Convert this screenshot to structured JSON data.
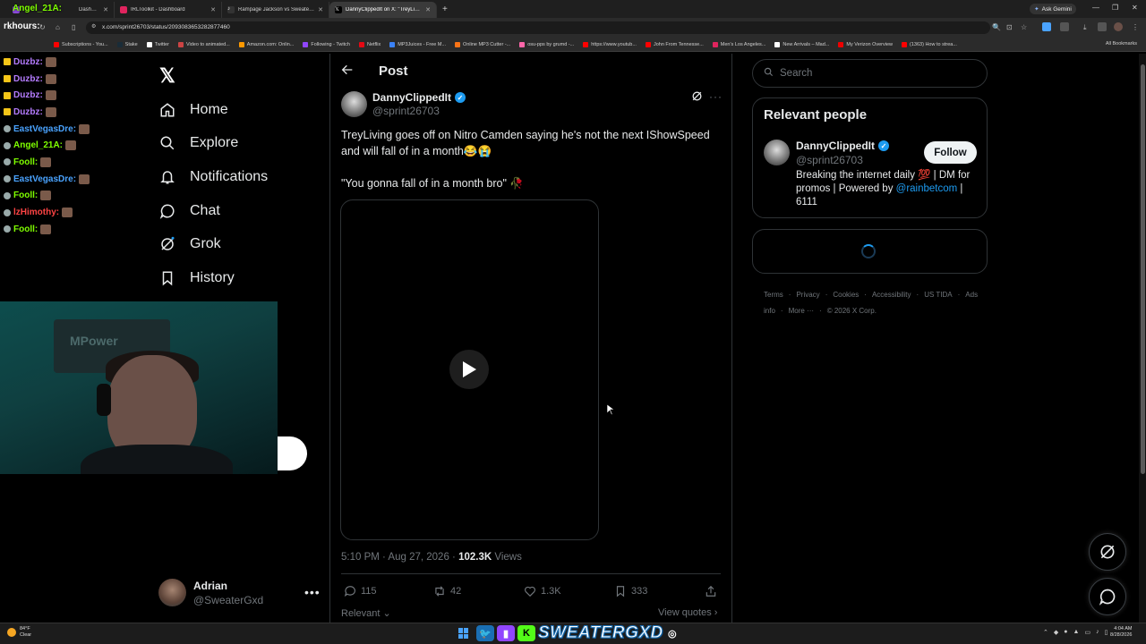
{
  "browser": {
    "tabs": [
      {
        "label": "Dashboard",
        "color": "#8a4bd8"
      },
      {
        "label": "IRLToolkit - Dashboard",
        "color": "#e0245e"
      },
      {
        "label": "Rampage Jackson vs Sweatergxd",
        "color": "#ffffff"
      },
      {
        "label": "DannyClippedIt on X: \"TreyLivi...",
        "color": "#ffffff"
      }
    ],
    "new_tab": "+",
    "ask_gemini": "Ask Gemini",
    "url": "x.com/sprint26703/status/2093083653282877460",
    "bookmarks": [
      {
        "label": "Subscriptions - You...",
        "color": "#ff0000"
      },
      {
        "label": "Stake",
        "color": "#1a2c38"
      },
      {
        "label": "Twitter",
        "color": "#ffffff"
      },
      {
        "label": "Video to animated...",
        "color": "#cc4444"
      },
      {
        "label": "Amazon.com: Onlin...",
        "color": "#ff9900"
      },
      {
        "label": "Following - Twitch",
        "color": "#9146ff"
      },
      {
        "label": "Netflix",
        "color": "#e50914"
      },
      {
        "label": "MP3Juices - Free M...",
        "color": "#3b82f6"
      },
      {
        "label": "Online MP3 Cutter -...",
        "color": "#f97316"
      },
      {
        "label": "osu-pps by grumd -...",
        "color": "#ff66aa"
      },
      {
        "label": "https://www.youtub...",
        "color": "#ff0000"
      },
      {
        "label": "John From Tennesse...",
        "color": "#ff0000"
      },
      {
        "label": "Men's Los Angeles...",
        "color": "#e0245e"
      },
      {
        "label": "New Arrivals – Mad...",
        "color": "#ffffff"
      },
      {
        "label": "My Verizon Overview",
        "color": "#ee0000"
      },
      {
        "label": "(1363) How to strea...",
        "color": "#ff0000"
      }
    ],
    "all_bookmarks": "All Bookmarks"
  },
  "overlay": {
    "title": "Angel_21A:",
    "subtitle": "rkhours:",
    "chat": [
      {
        "user": "Duzbz:",
        "color": "#b57cff"
      },
      {
        "user": "Duzbz:",
        "color": "#b57cff"
      },
      {
        "user": "Duzbz:",
        "color": "#b57cff"
      },
      {
        "user": "Duzbz:",
        "color": "#b57cff"
      },
      {
        "user": "EastVegasDre:",
        "color": "#4aa3ff"
      },
      {
        "user": "Angel_21A:",
        "color": "#7fff00"
      },
      {
        "user": "Fooll:",
        "color": "#7fff00"
      },
      {
        "user": "EastVegasDre:",
        "color": "#4aa3ff"
      },
      {
        "user": "Fooll:",
        "color": "#7fff00"
      },
      {
        "user": "lzHimothy:",
        "color": "#ff4444"
      },
      {
        "user": "Fooll:",
        "color": "#7fff00"
      }
    ]
  },
  "webcam": {
    "poster_text": "MPower"
  },
  "nav": {
    "logo": "𝕏",
    "items": [
      {
        "label": "Home",
        "icon": "home-icon"
      },
      {
        "label": "Explore",
        "icon": "search-icon"
      },
      {
        "label": "Notifications",
        "icon": "bell-icon"
      },
      {
        "label": "Chat",
        "icon": "chat-icon"
      },
      {
        "label": "Grok",
        "icon": "grok-icon"
      },
      {
        "label": "History",
        "icon": "bookmark-icon"
      }
    ]
  },
  "profile": {
    "name": "Adrian",
    "handle": "@SweaterGxd",
    "more": "•••"
  },
  "post": {
    "header": "Post",
    "author_name": "DannyClippedIt",
    "author_handle": "@sprint26703",
    "text_line1": "TreyLiving goes off on Nitro Camden saying he's not the next IShowSpeed and will fall of in a month😂😭",
    "text_line2": "\"You gonna fall of in a month bro\" 🥀",
    "time": "5:10 PM · Aug 27, 2026 · ",
    "views_count": "102.3K",
    "views_label": " Views",
    "replies": "115",
    "reposts": "42",
    "likes": "1.3K",
    "bookmarks": "333",
    "relevant": "Relevant",
    "view_quotes": "View quotes"
  },
  "right": {
    "search_placeholder": "Search",
    "relevant_title": "Relevant people",
    "rp_name": "DannyClippedIt",
    "rp_handle": "@sprint26703",
    "follow": "Follow",
    "bio_text": "Breaking the internet daily 💯 | DM for promos | Powered by ",
    "bio_link": "@rainbetcom",
    "bio_end": " | 6111",
    "footer": [
      "Terms",
      "·",
      "Privacy",
      "·",
      "Cookies",
      "·",
      "Accessibility",
      "·",
      "US TIDA",
      "·",
      "Ads info",
      "·",
      "More ···",
      "·",
      "© 2026 X Corp."
    ]
  },
  "taskbar": {
    "temp": "84°F",
    "condition": "Clear",
    "brand": "SWEATERGXD",
    "time": "4:04 AM",
    "date": "8/28/2026"
  }
}
